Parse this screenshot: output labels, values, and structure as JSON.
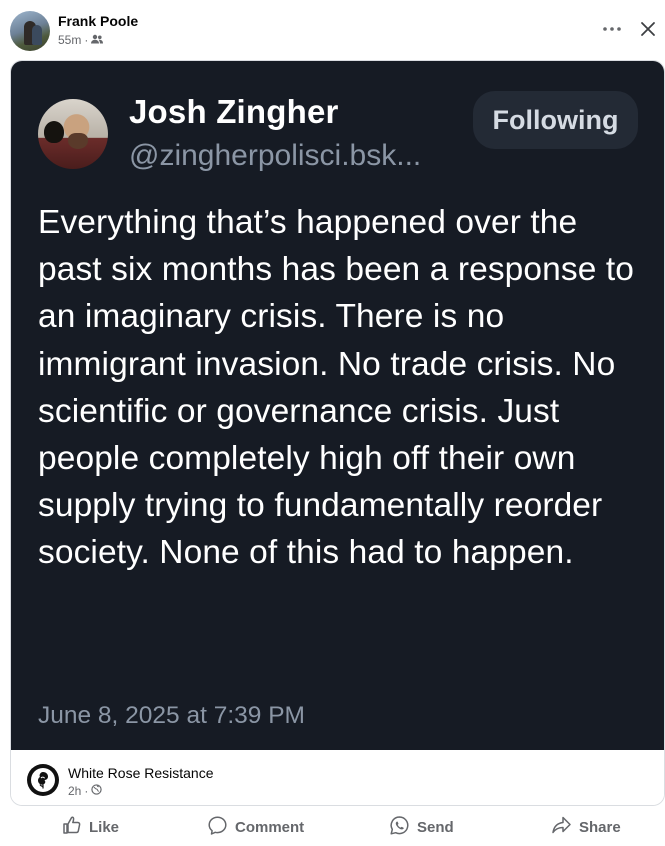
{
  "post": {
    "author": "Frank Poole",
    "time": "55m",
    "separator": "·",
    "audience_icon": "friends-icon"
  },
  "quoted": {
    "name": "Josh Zingher",
    "handle": "@zingherpolisci.bsk...",
    "follow_label": "Following",
    "text": "Everything that’s happened over the past six months has been a response to an imaginary crisis. There is no immigrant invasion. No trade crisis. No scientific or governance crisis. Just people completely high off their own supply trying to fundamentally reorder society. None of this had to happen.",
    "date": "June 8, 2025 at 7:39 PM"
  },
  "source": {
    "name": "White Rose Resistance",
    "time": "2h",
    "separator": "·",
    "audience_icon": "globe-icon"
  },
  "actions": {
    "like": "Like",
    "comment": "Comment",
    "send": "Send",
    "share": "Share"
  },
  "colors": {
    "card_background": "#161b24",
    "muted_text": "#65676b",
    "follow_button": "#232a35"
  }
}
